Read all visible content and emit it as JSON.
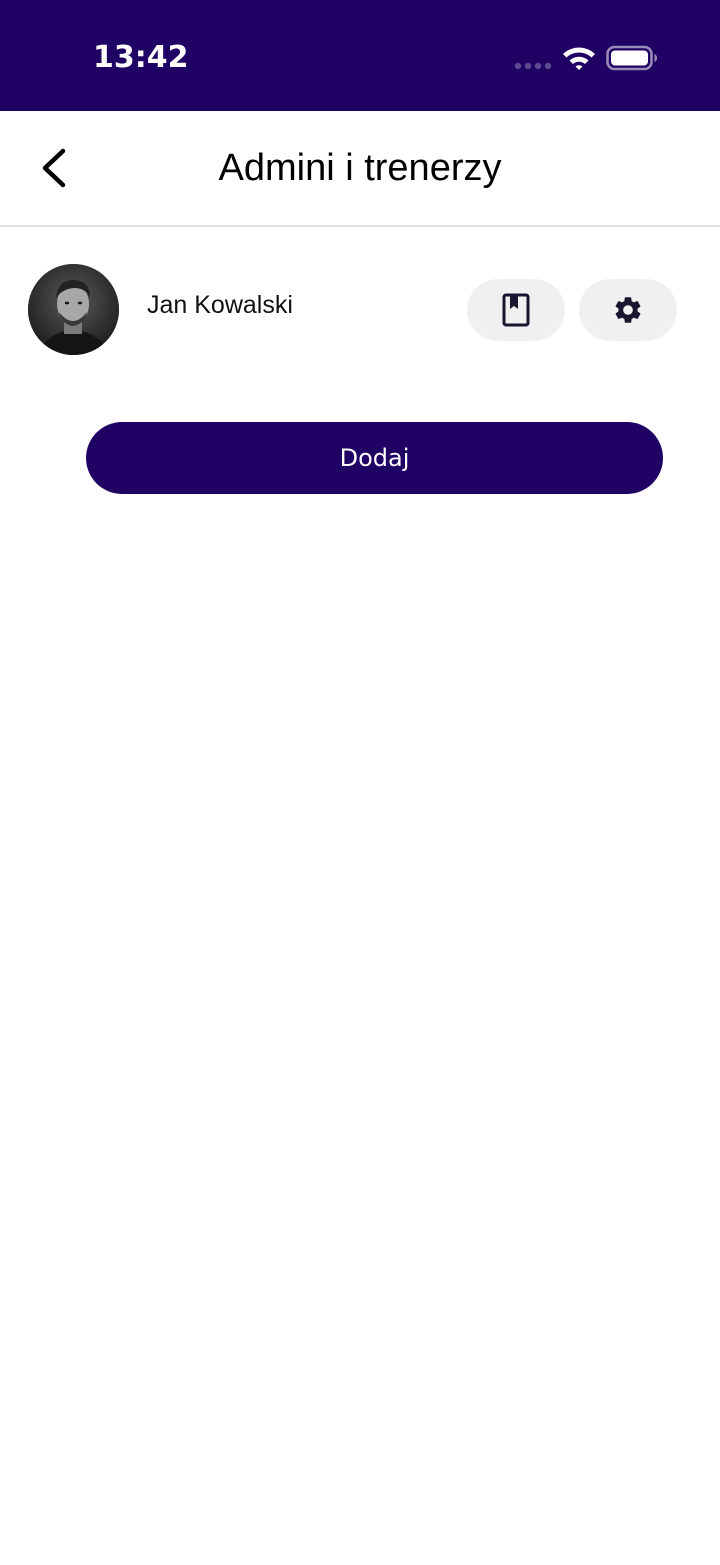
{
  "status_bar": {
    "time": "13:42",
    "background": "#200264",
    "icons": [
      "signal-icon",
      "wifi-icon",
      "battery-icon"
    ]
  },
  "header": {
    "title": "Admini i trenerzy",
    "back_icon": "chevron-left-icon"
  },
  "members": [
    {
      "name": "Jan Kowalski",
      "actions": [
        "bookmark-icon",
        "gear-icon"
      ]
    }
  ],
  "add_button": {
    "label": "Dodaj",
    "color": "#200264"
  },
  "colors": {
    "accent": "#200264",
    "pill_bg": "#f0f0f0",
    "icon": "#1a1630"
  }
}
